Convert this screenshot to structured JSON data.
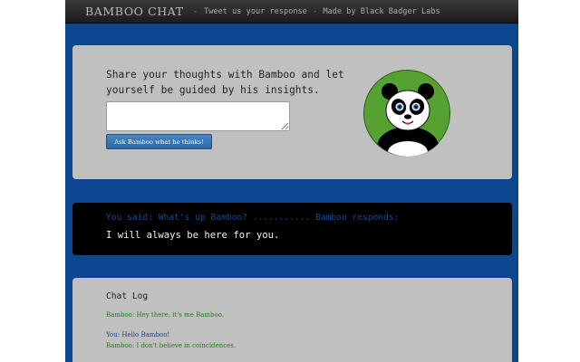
{
  "navbar": {
    "brand": "BAMBOO CHAT",
    "separator": "-",
    "tweet_link": "Tweet us your response",
    "made_by": "Made by Black Badger Labs"
  },
  "input_panel": {
    "prompt": "Share your thoughts with Bamboo and let yourself be guided by his insights.",
    "input_value": "",
    "ask_button_label": "Ask Bamboo what he thinks!"
  },
  "response_panel": {
    "said_line": "You said: What's up Bamboo? ........... Bamboo responds:",
    "response": "I will always be here for you."
  },
  "chat_log": {
    "title": "Chat Log",
    "entries": [
      {
        "speaker": "bamboo",
        "text": "Bamboo: Hey there, it's me Bamboo."
      },
      {
        "speaker": "user",
        "text": "You: Hello Bamboo!"
      },
      {
        "speaker": "bamboo",
        "text": "Bamboo: I don't believe in coincidences."
      }
    ]
  },
  "colors": {
    "page_background": "#0d4690",
    "navbar": "#262626",
    "panel": "#c0c0c0",
    "response_panel": "#000000",
    "said_text": "#16479a",
    "bamboo_log_text": "#1e7d16",
    "user_log_text": "#1d3f8f",
    "button": "#3571b0",
    "avatar_ring": "#55a233"
  },
  "icons": {
    "avatar": "panda-face-icon"
  }
}
